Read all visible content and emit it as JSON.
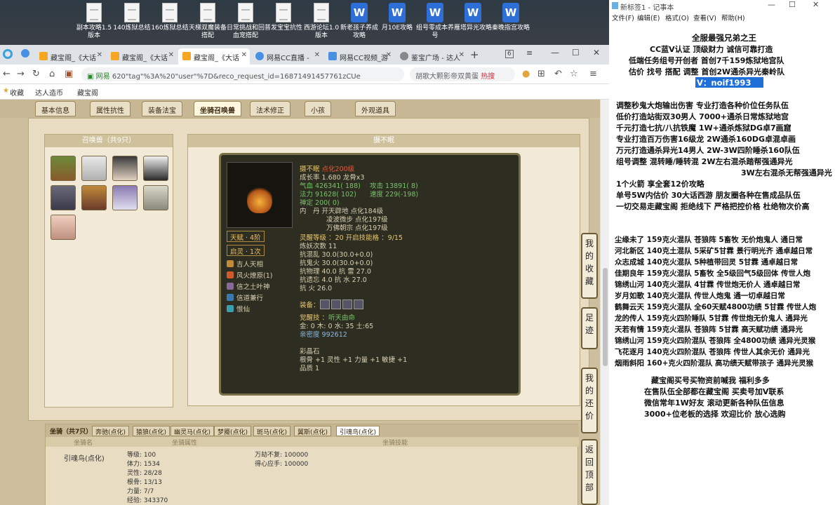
{
  "desktop_icons": [
    {
      "label": "副本攻略1.5版本",
      "type": "doc"
    },
    {
      "label": "140炼狱总结",
      "type": "doc"
    },
    {
      "label": "160炼狱总结",
      "type": "doc"
    },
    {
      "label": "天梯双魔装备搭配",
      "type": "doc"
    },
    {
      "label": "日常挑战和回血宠搭配",
      "type": "doc"
    },
    {
      "label": "普发宝宝抗性",
      "type": "doc"
    },
    {
      "label": "西游论坛1.0版本",
      "type": "doc"
    },
    {
      "label": "新老孩子养成攻略",
      "type": "wps"
    },
    {
      "label": "月10E攻略",
      "type": "wps"
    },
    {
      "label": "组号零成本养号",
      "type": "wps"
    },
    {
      "label": "雁塔异光攻略",
      "type": "wps"
    },
    {
      "label": "秦晚指宫攻略",
      "type": "wps"
    }
  ],
  "browser": {
    "tabs": [
      {
        "label": "藏宝阁_《大话",
        "color": "#f5a623"
      },
      {
        "label": "藏宝阁_《大话",
        "color": "#f5a623"
      },
      {
        "label": "藏宝阁_《大话",
        "color": "#f5a623",
        "active": true
      },
      {
        "label": "网易CC直播 -",
        "color": "#4a90e2"
      },
      {
        "label": "网易CC视频_游",
        "color": "#4a90e2"
      },
      {
        "label": "鉴宝广场 - 达人",
        "color": "#888"
      }
    ],
    "tab_count": "6",
    "url_site": "网易",
    "url": "620\"tag\"%3A%20\"user\"%7D&reco_request_id=16871491457761zCUe",
    "search_text": "胡歌大颗影帝双黄蛋",
    "hot_label": "热搜",
    "favorites": [
      "收藏",
      "达人造币",
      "藏宝阁"
    ]
  },
  "game": {
    "tabs": [
      "基本信息",
      "属性抗性",
      "装备法宝",
      "坐骑召唤兽",
      "法术修正",
      "小孩",
      "外观道具"
    ],
    "active_tab": 3,
    "summon_header": "召唤兽（共9只）",
    "detail_header": "摄不眠",
    "pet": {
      "name": "摄不眠",
      "name_note": "点化200级",
      "growth": "成长率 1.680 龙骨x3",
      "hp": "气血 426341( 188)",
      "atk": "攻击 13891( 8)",
      "mp": "法力 91628( 102)",
      "spd": "速度 229(-198)",
      "zen": "禅定 200( 0)",
      "inner1": "内　丹 开天辟地 点化184级",
      "inner2": "凌波微步 点化197级",
      "inner3": "万佛朝宗 点化197级",
      "talent": "天赋 · 4阶",
      "qiling": "启灵 · 1次",
      "soul": "灵醒等级 ：20 开启技能格 ：9/15",
      "refine": "炼妖次数 11",
      "r1": "抗混乱 30.0(30.0+0.0)",
      "r2": "抗鬼火 30.0(30.0+0.0)",
      "r3": "抗物理 40.0 抗 雷 27.0",
      "r4": "抗遗忘 4.0 抗 水 27.0",
      "r5": "抗 火 26.0",
      "equip_label": "装备：",
      "awaken": "觉醒技 ：",
      "awaken_skill": "听天由命",
      "elements": "金: 0 木: 0 水: 35 土:65",
      "intimacy": "亲密度 992612",
      "stone_title": "彩晶石",
      "stone": "根骨 +1 灵性 +1 力量 +1 敏捷 +1",
      "quality": "品质 1",
      "skills": [
        "吉人天相",
        "风火燎原(1)",
        "信之土叶神",
        "信道兼行",
        "恨仙"
      ]
    },
    "mount": {
      "tabs": [
        "坐骑（共7只）",
        "奔驰(点化)",
        "猿狼(点化)",
        "幽灵马(点化)",
        "梦魇(点化)",
        "斑马(点化)",
        "翼斯(点化)",
        "引魂鸟(点化)"
      ],
      "active": 7,
      "name": "引魂鸟(点化)",
      "stats": [
        "等级: 100",
        "体力: 1534",
        "灵性: 28/28",
        "根骨: 13/13",
        "力量: 7/7",
        "经验: 343370"
      ],
      "skills": [
        "万劫不复: 100000",
        "得心应手: 100000"
      ],
      "col1": "坐骑名",
      "col2": "坐骑属性",
      "col3": "坐骑技能"
    },
    "side_buttons": [
      "我的收藏",
      "足迹",
      "我的还价",
      "返回顶部"
    ]
  },
  "notepad": {
    "title": "新标签1 - 记事本",
    "menu": [
      "文件(F)",
      "编辑(E)",
      "格式(O)",
      "查看(V)",
      "帮助(H)"
    ],
    "lines": [
      "全服最强兄弟之王",
      "CC蓝V认证 顶级财力 诚信可靠打造",
      "低端任务组号开创者      首创7千159炼狱地宫队",
      "估价 找号 搭配 调整       首创2W通杀异光秦岭队",
      "V：noif1993",
      "调整秒鬼大炮输出伤害          专业打造各种价位任务队伍",
      "低价打造站街双30男人            7000+通杀日常炼狱地宫",
      "千元打造七抗/八抗铁魔          1W+通杀炼狱DG卓7画窟",
      "专业打造百万伤害16级龙           2W通杀160DG卓混卓画",
      "万元打造通杀异光14男人         2W-3W四阶睡杀160队伍",
      "组号调整 混转睡/睡转混             2W左右混杀踏帮强通异光",
      "3W左右混杀无帮强通异光",
      "1个火箭 享全套12价攻略",
      "单号5W内估价 30大话西游          朋友圈各种在售成品队伍",
      "一切交易走藏宝阁 拒绝线下     严格把控价格 杜绝物次价高",
      "尘缘未了 159克火混队 苍狼阵 5畜牧 无价炮鬼人 通日常",
      "河北新区 140克土混队 5采矿5甘霖 景行明光齐 通卓越日常",
      "众志成城 140克火混队 5种植带回灵 5甘霖 通卓越日常",
      "佳期良年 159克火混队 5畜牧 全5级回气5级回体 传世人炮",
      "锦绣山河 140克火混队 4甘霖 传世炮无价人 通卓越日常",
      "岁月如歌 140克火混队 传世人炮鬼 通一切卓越日常",
      "鹤舞云天 159克火混队 全60天赋4800功绩 5甘霖 传世人炮",
      "龙的传人 159克火四阶睡队 5甘霖 传世炮无价鬼人 通异光",
      "天若有情 159克火混队 苍狼阵 5甘霖 高天赋功绩 通异光",
      "锦绣山河 159克火四阶混队 苍狼阵 全4800功绩 通异光灵猴",
      "飞花逐月 140克火四阶混队 苍狼阵 传世人其余无价 通异光",
      "烟雨斜阳 160+克火四阶混队 高功绩天赋带孩子 通异光灵猴",
      "藏宝阁买号买物资前喊我 福利多多",
      "在售队伍全部都在藏宝阁 买卖号加V联系",
      "微信常年1W好友 滚动更新各种队伍信息",
      "3000+位老板的选择 欢迎比价 放心选购"
    ]
  }
}
